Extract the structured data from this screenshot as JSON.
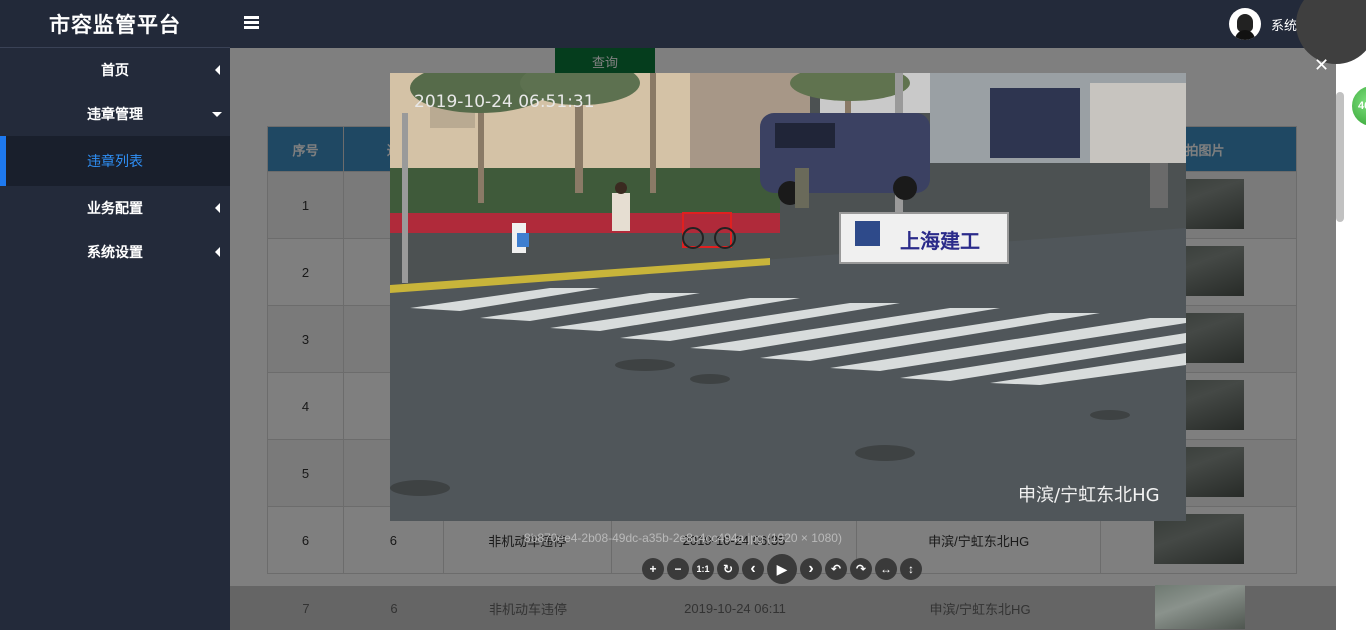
{
  "app": {
    "title": "市容监管平台"
  },
  "header": {
    "user_name": "系统管理员"
  },
  "sidebar": {
    "items": [
      {
        "label": "首页"
      },
      {
        "label": "违章管理"
      },
      {
        "label": "违章列表"
      },
      {
        "label": "业务配置"
      },
      {
        "label": "系统设置"
      }
    ]
  },
  "main": {
    "search_label": "查询",
    "table": {
      "headers": [
        "序号",
        "通",
        "违拍图片"
      ],
      "rows": [
        {
          "index": "1"
        },
        {
          "index": "2"
        },
        {
          "index": "3"
        },
        {
          "index": "4"
        },
        {
          "index": "5"
        },
        {
          "index": "6",
          "col2": "6",
          "col3": "非机动车违停",
          "col4": "2019-10-24 06:35",
          "col5": "申滨/宁虹东北HG"
        },
        {
          "index": "7",
          "col2": "6",
          "col3": "非机动车违停",
          "col4": "2019-10-24 06:11",
          "col5": "申滨/宁虹东北HG"
        }
      ]
    }
  },
  "viewer": {
    "timestamp": "2019-10-24 06:51:31",
    "location": "申滨/宁虹东北HG",
    "sign": "上海建工",
    "caption": "8b870ee4-2b08-49dc-a35b-2e8c4cc494a.jpg (1920 × 1080)",
    "badge": "46",
    "toolbar": {
      "zoom_in": "+",
      "zoom_out": "−",
      "one_to_one": "1:1",
      "reset": "↻",
      "prev": "‹",
      "play": "▶",
      "next": "›",
      "rotate_left": "↶",
      "rotate_right": "↷",
      "flip_h": "↔",
      "flip_v": "↕"
    }
  }
}
